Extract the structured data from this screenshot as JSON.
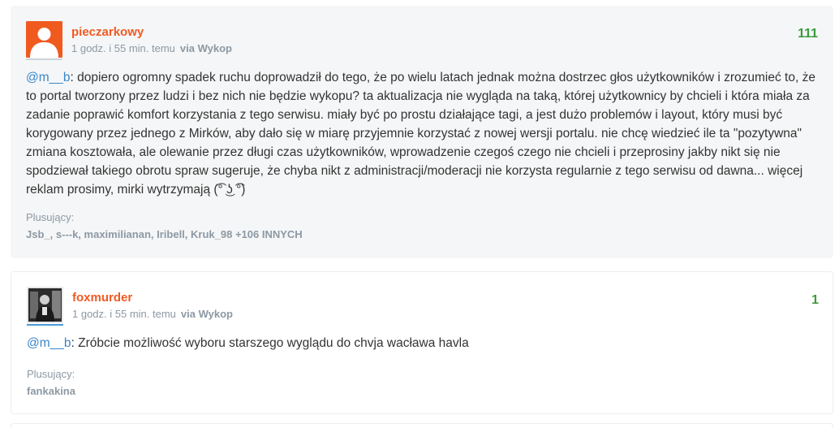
{
  "comments": [
    {
      "author": "pieczarkowy",
      "time": "1 godz. i 55 min. temu",
      "via": "via Wykop",
      "votes": "111",
      "mention": "@m__b",
      "text": ": dopiero ogromny spadek ruchu doprowadził do tego, że po wielu latach jednak można dostrzec głos użytkowników i zrozumieć to, że to portal tworzony przez ludzi i bez nich nie będzie wykopu? ta aktualizacja nie wygląda na taką, której użytkownicy by chcieli i która miała za zadanie poprawić komfort korzystania z tego serwisu. miały być po prostu działające tagi, a jest dużo problemów i layout, który musi być korygowany przez jednego z Mirków, aby dało się w miarę przyjemnie korzystać z nowej wersji portalu. nie chcę wiedzieć ile ta \"pozytywna\" zmiana kosztowała, ale olewanie przez długi czas użytkowników, wprowadzenie czegoś czego nie chcieli i przeprosiny jakby nikt się nie spodziewał takiego obrotu spraw sugeruje, że chyba nikt z administracji/moderacji nie korzysta regularnie z tego serwisu od dawna... więcej reklam prosimy, mirki wytrzymają (͡° ͜ʖ ͡°)",
      "plus_label": "Plusujący:",
      "plus_users": "Jsb_, s---k, maximilianan, Iribell, Kruk_98",
      "plus_more": "+106 INNYCH"
    },
    {
      "author": "foxmurder",
      "time": "1 godz. i 55 min. temu",
      "via": "via Wykop",
      "votes": "1",
      "mention": "@m__b",
      "text": ": Zróbcie możliwość wyboru starszego wyglądu do chvja wacława havla",
      "plus_label": "Plusujący:",
      "plus_users": "fankakina"
    }
  ],
  "colors": {
    "author": "#f15a22",
    "mention": "#3a86c8",
    "votes": "#3b9a3b",
    "meta": "#8c99a4"
  },
  "icons": [
    "user-avatar-icon",
    "photo-avatar-icon"
  ]
}
